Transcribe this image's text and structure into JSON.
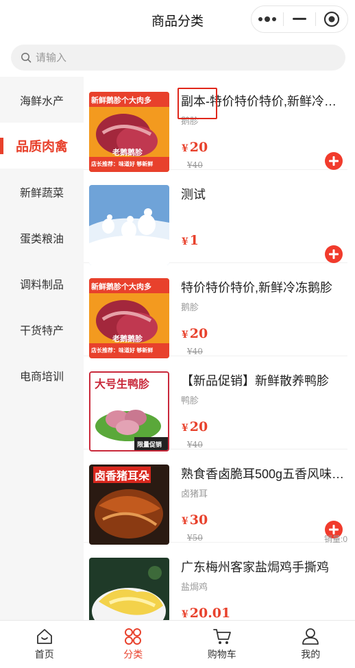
{
  "header": {
    "title": "商品分类"
  },
  "search": {
    "placeholder": "请输入"
  },
  "sidebar": {
    "items": [
      {
        "label": "海鲜水产"
      },
      {
        "label": "品质肉禽",
        "active": true
      },
      {
        "label": "新鲜蔬菜"
      },
      {
        "label": "蛋类粮油"
      },
      {
        "label": "调料制品"
      },
      {
        "label": "干货特产"
      },
      {
        "label": "电商培训"
      }
    ]
  },
  "products": [
    {
      "name": "副本-特价特价特价,新鲜冷冻鹅胗",
      "sub": "鹅胗",
      "currency": "¥",
      "price": "20",
      "original_price": "¥40",
      "image_caption_top": "新鲜鹅胗个大肉多",
      "image_caption_mid": "老鹅鹅胗",
      "image_caption_bottom": "店长推荐：味道好 够新鲜"
    },
    {
      "name": "测试",
      "sub": "",
      "currency": "¥",
      "price": "1",
      "original_price": ""
    },
    {
      "name": "特价特价特价,新鲜冷冻鹅胗",
      "sub": "鹅胗",
      "currency": "¥",
      "price": "20",
      "original_price": "¥40",
      "image_caption_top": "新鲜鹅胗个大肉多",
      "image_caption_mid": "老鹅鹅胗",
      "image_caption_bottom": "店长推荐：味道好 够新鲜"
    },
    {
      "name": "【新品促销】新鲜散养鸭胗",
      "sub": "鸭胗",
      "currency": "¥",
      "price": "20",
      "original_price": "¥40",
      "image_caption_top": "大号生鸭胗",
      "image_caption_badge": "限量促销"
    },
    {
      "name": "熟食香卤脆耳500g五香风味猪耳朵",
      "sub": "卤猪耳",
      "currency": "¥",
      "price": "30",
      "original_price": "¥50",
      "sales": "销量:0",
      "image_caption_top": "卤香猪耳朵"
    },
    {
      "name": "广东梅州客家盐焗鸡手撕鸡",
      "sub": "盐焗鸡",
      "currency": "¥",
      "price": "20.01",
      "original_price": ""
    }
  ],
  "tabbar": {
    "items": [
      {
        "label": "首页"
      },
      {
        "label": "分类",
        "active": true
      },
      {
        "label": "购物车"
      },
      {
        "label": "我的"
      }
    ]
  },
  "colors": {
    "accent": "#e8412c",
    "add_button": "#f13b2c"
  }
}
